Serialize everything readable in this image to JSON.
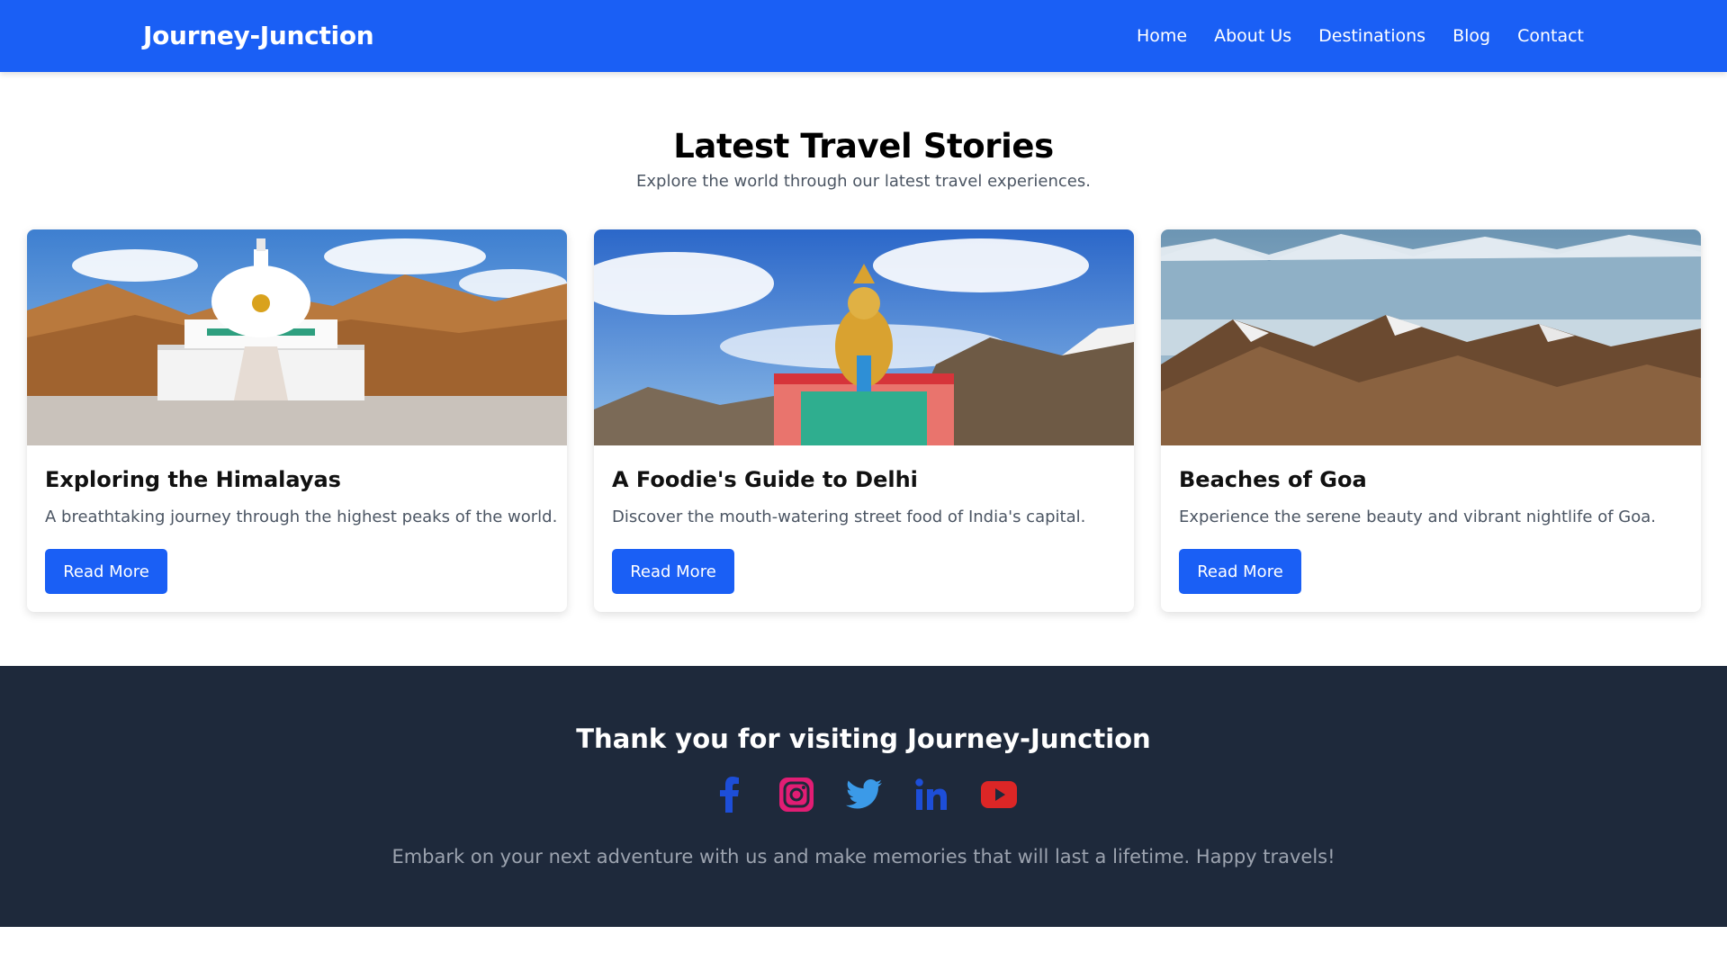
{
  "navbar": {
    "brand": "Journey-Junction",
    "links": [
      {
        "label": "Home"
      },
      {
        "label": "About Us"
      },
      {
        "label": "Destinations"
      },
      {
        "label": "Blog"
      },
      {
        "label": "Contact"
      }
    ]
  },
  "section": {
    "title": "Latest Travel Stories",
    "subtitle": "Explore the world through our latest travel experiences."
  },
  "cards": [
    {
      "title": "Exploring the Himalayas",
      "description": "A breathtaking journey through the highest peaks of the world.",
      "button": "Read More",
      "image": "stupa-mountain-photo"
    },
    {
      "title": "A Foodie's Guide to Delhi",
      "description": "Discover the mouth-watering street food of India's capital.",
      "button": "Read More",
      "image": "buddha-statue-photo"
    },
    {
      "title": "Beaches of Goa",
      "description": "Experience the serene beauty and vibrant nightlife of Goa.",
      "button": "Read More",
      "image": "mountain-valley-photo"
    }
  ],
  "footer": {
    "title": "Thank you for visiting Journey-Junction",
    "note": "Embark on your next adventure with us and make memories that will last a lifetime. Happy travels!",
    "socials": [
      {
        "icon": "facebook-icon",
        "color": "#1d4ed8"
      },
      {
        "icon": "instagram-icon",
        "color": "#e11d74"
      },
      {
        "icon": "twitter-icon",
        "color": "#3b9ae8"
      },
      {
        "icon": "linkedin-icon",
        "color": "#1d4ed8"
      },
      {
        "icon": "youtube-icon",
        "color": "#dc2626"
      }
    ]
  },
  "colors": {
    "primary": "#1a5ff5",
    "footer_bg": "#1e293b",
    "muted_text": "#4b5563"
  }
}
